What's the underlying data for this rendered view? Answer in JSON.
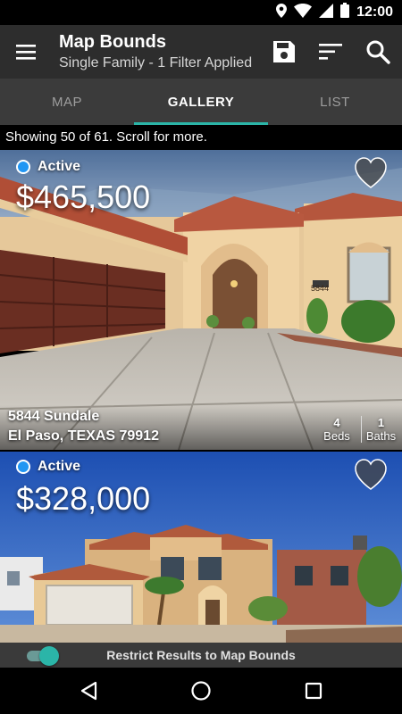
{
  "status_bar": {
    "time": "12:00",
    "icons": [
      "location-icon",
      "wifi-icon",
      "signal-icon",
      "battery-icon"
    ]
  },
  "toolbar": {
    "title": "Map Bounds",
    "subtitle": "Single Family - 1 Filter Applied",
    "icons": [
      "menu-icon",
      "save-icon",
      "sort-icon",
      "search-icon"
    ]
  },
  "tabs": [
    {
      "label": "MAP",
      "active": false
    },
    {
      "label": "GALLERY",
      "active": true
    },
    {
      "label": "LIST",
      "active": false
    }
  ],
  "results_info": "Showing 50 of 61. Scroll for more.",
  "listings": [
    {
      "status": "Active",
      "price": "$465,500",
      "address_line1": "5844 Sundale",
      "address_line2": "El Paso, TEXAS 79912",
      "beds": "4",
      "beds_label": "Beds",
      "baths": "1",
      "baths_label": "Baths",
      "house_number_sign": "5844"
    },
    {
      "status": "Active",
      "price": "$328,000"
    }
  ],
  "restrict_toggle": {
    "label": "Restrict Results to Map Bounds",
    "enabled": true
  },
  "nav": {
    "icons": [
      "back-icon",
      "home-icon",
      "recents-icon"
    ]
  },
  "colors": {
    "accent": "#2bb5a8",
    "status_active": "#2196f3",
    "toolbar_bg": "#2d2d2d",
    "tabs_bg": "#3b3b3b"
  }
}
